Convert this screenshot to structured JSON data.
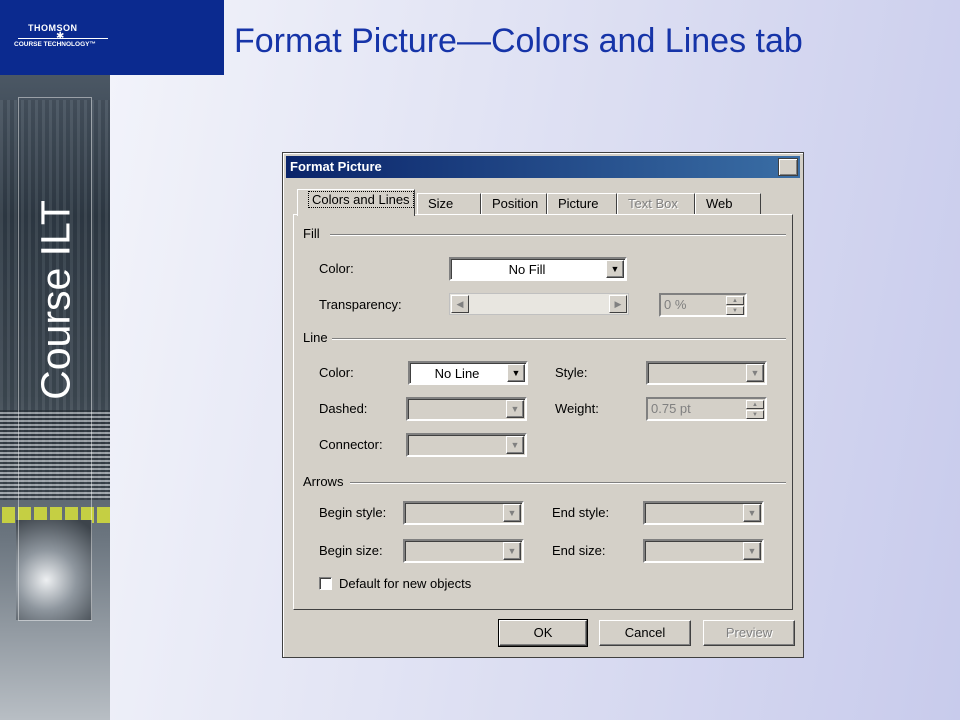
{
  "slide": {
    "title": "Format Picture—Colors and Lines tab",
    "side_title": "Course ILT",
    "logo_top": "THOMSON",
    "logo_bottom": "COURSE TECHNOLOGY",
    "logo_tm": "™"
  },
  "dialog": {
    "title": "Format Picture",
    "close_glyph": "✕",
    "tabs": [
      {
        "label": "Colors and Lines",
        "active": true,
        "enabled": true
      },
      {
        "label": "Size",
        "active": false,
        "enabled": true
      },
      {
        "label": "Position",
        "active": false,
        "enabled": true
      },
      {
        "label": "Picture",
        "active": false,
        "enabled": true
      },
      {
        "label": "Text Box",
        "active": false,
        "enabled": false
      },
      {
        "label": "Web",
        "active": false,
        "enabled": true
      }
    ],
    "fill": {
      "section_label": "Fill",
      "color_label": "Color:",
      "color_value": "No Fill",
      "transparency_label": "Transparency:",
      "transparency_value": "0 %"
    },
    "line": {
      "section_label": "Line",
      "color_label": "Color:",
      "color_value": "No Line",
      "style_label": "Style:",
      "dashed_label": "Dashed:",
      "weight_label": "Weight:",
      "weight_value": "0.75 pt",
      "connector_label": "Connector:"
    },
    "arrows": {
      "section_label": "Arrows",
      "begin_style_label": "Begin style:",
      "end_style_label": "End style:",
      "begin_size_label": "Begin size:",
      "end_size_label": "End size:"
    },
    "default_checkbox_label": "Default for new objects",
    "default_checked": false,
    "buttons": {
      "ok": "OK",
      "cancel": "Cancel",
      "preview": "Preview"
    },
    "icons": {
      "dropdown_arrow": "▼",
      "left_arrow": "◀",
      "right_arrow": "▶",
      "spin_up": "▲",
      "spin_down": "▼"
    }
  }
}
